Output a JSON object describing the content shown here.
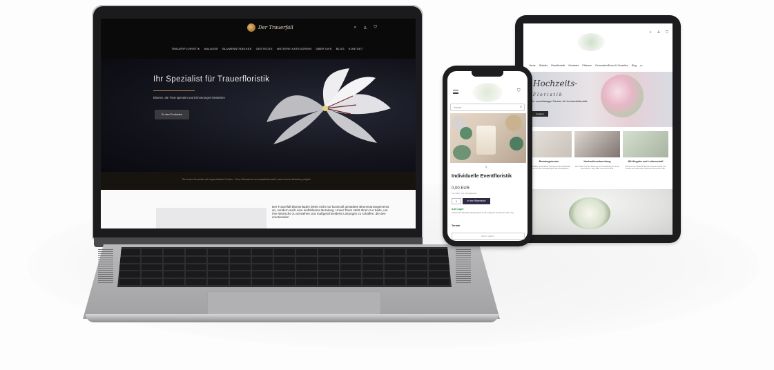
{
  "laptop": {
    "brand": "Der Trauerfall",
    "nav": [
      "TRAUERFLORISTIK",
      "ANLÄSSE",
      "BLUMENSTRÄUSSE",
      "GESTECKE",
      "WEITERE KATEGORIEN",
      "ÜBER UNS",
      "BLOG",
      "KONTAKT"
    ],
    "hero_title": "Ihr Spezialist für Trauerfloristik",
    "hero_subtitle": "Blumen, die Trost spenden und Erinnerungen bewahren",
    "hero_button": "Zu den Produkten",
    "band_text": "Die ist eine Demoseite mit eingeschränkter Funktion - Diese Webseite ist nur beispielhaft erstellt, daher ist keine Bestellung möglich",
    "intro_text": "Der Trauerfall Blumenladen bietet nicht nur kunstvoll gestaltete Blumenarrangements an, sondern auch eine einfühlsame Beratung. Unser Team steht Ihnen zur Seite, um Ihre Wünsche zu verstehen und maßgeschneiderte Lösungen zu schaffen, die den emotionalen"
  },
  "tablet": {
    "nav": [
      "Home",
      "Sträuße",
      "Brautfloristik",
      "Gestecke",
      "Pflanzen",
      "Dekoration/Event & Gestalten",
      "Blog",
      "•••"
    ],
    "hero_script": "Hochzeits-",
    "hero_script2": "Floristik",
    "hero_tagline": "Ihr zuverlässiger Partner für Hochzeitsfloristik",
    "hero_button": "Angebot",
    "cards": [
      {
        "title": "Beratungstermin",
        "desc": "Wir erstellen persönliche Arrangements individuell, und immer den Vorstellungen des Brautpaares."
      },
      {
        "title": "Hochzeitsvorbereitung",
        "desc": "Wir helfen bei der Planung und Gestaltung für Ihren besonderen Tag, alles aus einer Hand."
      },
      {
        "title": "Mit Hingabe und Leidenschaft",
        "desc": "Wir sind mit Leidenschaft bei unserer Arbeit und finden den schönsten Blumenschmuck für Sie."
      }
    ]
  },
  "phone": {
    "search_placeholder": "Suche",
    "product_title": "Individuelle Eventfloristik",
    "price": "0,00 EUR",
    "tax_note": "inkl. MwSt. zzgl. Versandkosten",
    "qty": "1",
    "add_button": "In den Warenkorb",
    "stock": "Auf Lager",
    "delivery_note": "Lieferzeit 2-3 Werktage. Bestellung bis 14 Uhr erfolgt der Versand am selben Tag.",
    "date_label": "Termin",
    "date_placeholder": "Datum wählen"
  }
}
